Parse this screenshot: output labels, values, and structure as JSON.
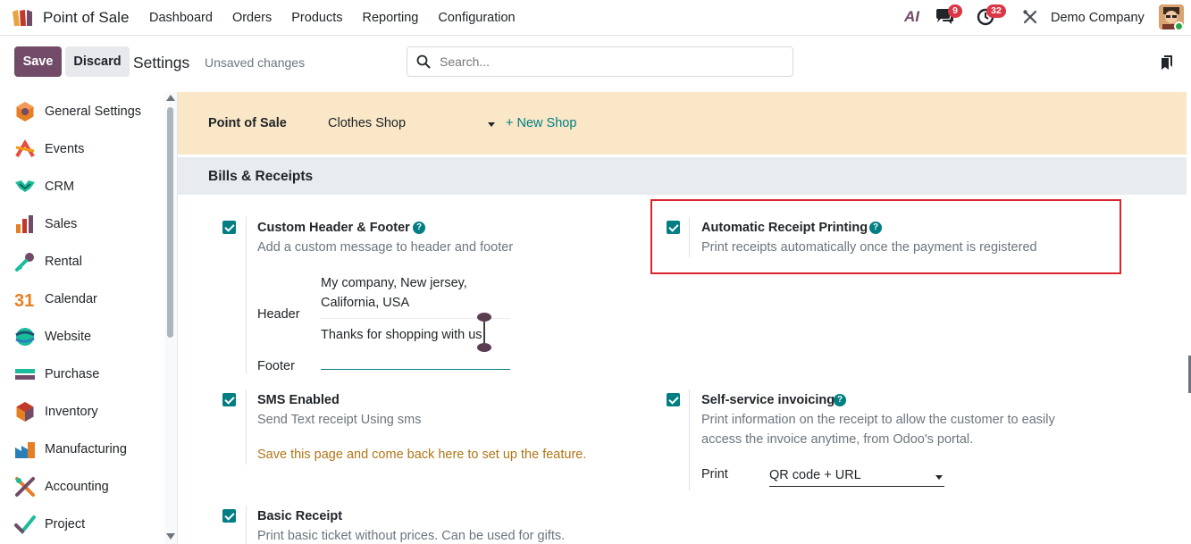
{
  "nav": {
    "app_name": "Point of Sale",
    "menu": [
      "Dashboard",
      "Orders",
      "Products",
      "Reporting",
      "Configuration"
    ],
    "ai_label": "AI",
    "chat_count": "9",
    "activity_count": "32",
    "company": "Demo Company"
  },
  "control": {
    "save_label": "Save",
    "discard_label": "Discard",
    "breadcrumb": "Settings",
    "status": "Unsaved changes",
    "search_placeholder": "Search..."
  },
  "sidebar": {
    "items": [
      {
        "label": "General Settings",
        "icon": "general-settings-icon"
      },
      {
        "label": "Events",
        "icon": "events-icon"
      },
      {
        "label": "CRM",
        "icon": "crm-icon"
      },
      {
        "label": "Sales",
        "icon": "sales-icon"
      },
      {
        "label": "Rental",
        "icon": "rental-icon"
      },
      {
        "label": "Calendar",
        "icon": "calendar-icon"
      },
      {
        "label": "Website",
        "icon": "website-icon"
      },
      {
        "label": "Purchase",
        "icon": "purchase-icon"
      },
      {
        "label": "Inventory",
        "icon": "inventory-icon"
      },
      {
        "label": "Manufacturing",
        "icon": "manufacturing-icon"
      },
      {
        "label": "Accounting",
        "icon": "accounting-icon"
      },
      {
        "label": "Project",
        "icon": "project-icon"
      }
    ],
    "calendar_number": "31"
  },
  "main": {
    "pos_label": "Point of Sale",
    "shop_value": "Clothes Shop",
    "new_shop_label": "+ New Shop",
    "section_title": "Bills & Receipts",
    "custom_header": {
      "title": "Custom Header & Footer",
      "desc": "Add a custom message to header and footer",
      "header_label": "Header",
      "header_line1": "My  company, New jersey,",
      "header_line2": "California, USA",
      "footer_label": "Footer",
      "footer_value": "Thanks for shopping with us"
    },
    "auto_print": {
      "title": "Automatic Receipt Printing",
      "desc": "Print receipts automatically once the payment is registered"
    },
    "sms": {
      "title": "SMS Enabled",
      "desc": "Send Text receipt Using sms",
      "warning": "Save this page and come back here to set up the feature."
    },
    "self_service": {
      "title": "Self-service invoicing",
      "desc_line1": "Print information on the receipt to allow the customer to easily",
      "desc_line2": "access the invoice anytime, from Odoo's portal.",
      "print_label": "Print",
      "print_value": "QR code + URL"
    },
    "basic_receipt": {
      "title": "Basic Receipt",
      "desc": "Print basic ticket without prices. Can be used for gifts."
    }
  },
  "colors": {
    "primary": "#714b67",
    "accent": "#017e84",
    "banner": "#f9e7c7",
    "highlight": "#d9232d",
    "warning": "#b07617"
  }
}
